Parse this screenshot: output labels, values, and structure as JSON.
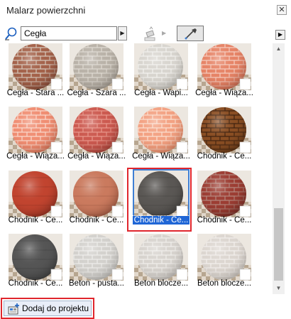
{
  "window": {
    "title": "Malarz powierzchni",
    "close_glyph": "✕"
  },
  "search": {
    "value": "Cegła"
  },
  "grid": {
    "tiles": [
      {
        "label": "Cegła - Stara ...",
        "style": "brick",
        "base": "#a4624a",
        "mortar": "#d7cbbf",
        "dark": "#5a2f22"
      },
      {
        "label": "Cegła - Szara ...",
        "style": "brick",
        "base": "#b9b2a8",
        "mortar": "#e0dbd3",
        "dark": "#6d665e"
      },
      {
        "label": "Cegła - Wapi...",
        "style": "brick",
        "base": "#d8d5cf",
        "mortar": "#f4f3f0",
        "dark": "#8a8781"
      },
      {
        "label": "Cegła - Wiąza...",
        "style": "brick",
        "base": "#e68467",
        "mortar": "#f6d0c3",
        "dark": "#8a4330"
      },
      {
        "label": "Cegła - Wiąza...",
        "style": "brick",
        "base": "#f08e73",
        "mortar": "#f9dcd0",
        "dark": "#9a4c36"
      },
      {
        "label": "Cegła - Wiąza...",
        "style": "brick",
        "base": "#cc5a50",
        "mortar": "#e99a8e",
        "dark": "#70271f"
      },
      {
        "label": "Cegła - Wiąza...",
        "style": "brick",
        "base": "#f3a283",
        "mortar": "#fbe2d4",
        "dark": "#a4583c"
      },
      {
        "label": "Chodnik - Ce...",
        "style": "brick",
        "base": "#8a4e23",
        "mortar": "#3e2210",
        "dark": "#3a1f0c"
      },
      {
        "label": "Chodnik - Ce...",
        "style": "smooth",
        "base": "#c1442f",
        "mortar": "#d4604c",
        "dark": "#5e1e14"
      },
      {
        "label": "Chodnik - Ce...",
        "style": "smooth",
        "base": "#ca7a5e",
        "mortar": "#dda28b",
        "dark": "#6a3525"
      },
      {
        "label": "Chodnik - Ce...",
        "style": "smooth",
        "base": "#5a5754",
        "mortar": "#7a7672",
        "dark": "#2a2826",
        "selected": true
      },
      {
        "label": "Chodnik - Ce...",
        "style": "brick",
        "base": "#9c3d33",
        "mortar": "#b58a80",
        "dark": "#4a1a14"
      },
      {
        "label": "Chodnik - Ce...",
        "style": "smooth",
        "base": "#555555",
        "mortar": "#6a6a6a",
        "dark": "#262626"
      },
      {
        "label": "Beton - pusta...",
        "style": "brick",
        "base": "#d3d1cd",
        "mortar": "#efeeec",
        "dark": "#858380"
      },
      {
        "label": "Beton blocze...",
        "style": "brick",
        "base": "#d7d3ce",
        "mortar": "#f1efec",
        "dark": "#888480"
      },
      {
        "label": "Beton blocze...",
        "style": "brick",
        "base": "#dcd6d0",
        "mortar": "#f3f0ed",
        "dark": "#8c8781"
      }
    ]
  },
  "footer": {
    "add_label": "Dodaj do projektu"
  },
  "colors": {
    "highlight": "#e0262d",
    "selection": "#1f66d6"
  }
}
